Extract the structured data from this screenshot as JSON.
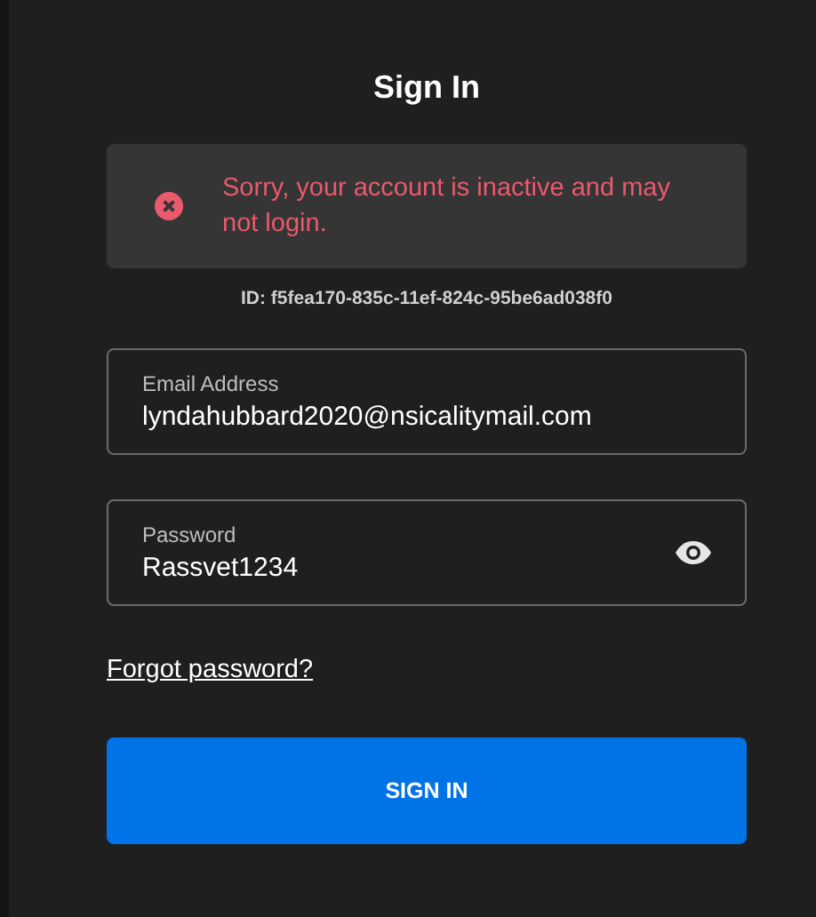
{
  "title": "Sign In",
  "alert": {
    "kind": "error",
    "message": "Sorry, your account is inactive and may not login."
  },
  "error_id": "ID: f5fea170-835c-11ef-824c-95be6ad038f0",
  "fields": [
    {
      "kind": "text",
      "label": "Email Address",
      "value": "lyndahubbard2020@nsicalitymail.com"
    },
    {
      "kind": "password",
      "label": "Password",
      "value": "Rassvet1234"
    }
  ],
  "forgot_link": "Forgot password?",
  "submit_button": "SIGN IN"
}
